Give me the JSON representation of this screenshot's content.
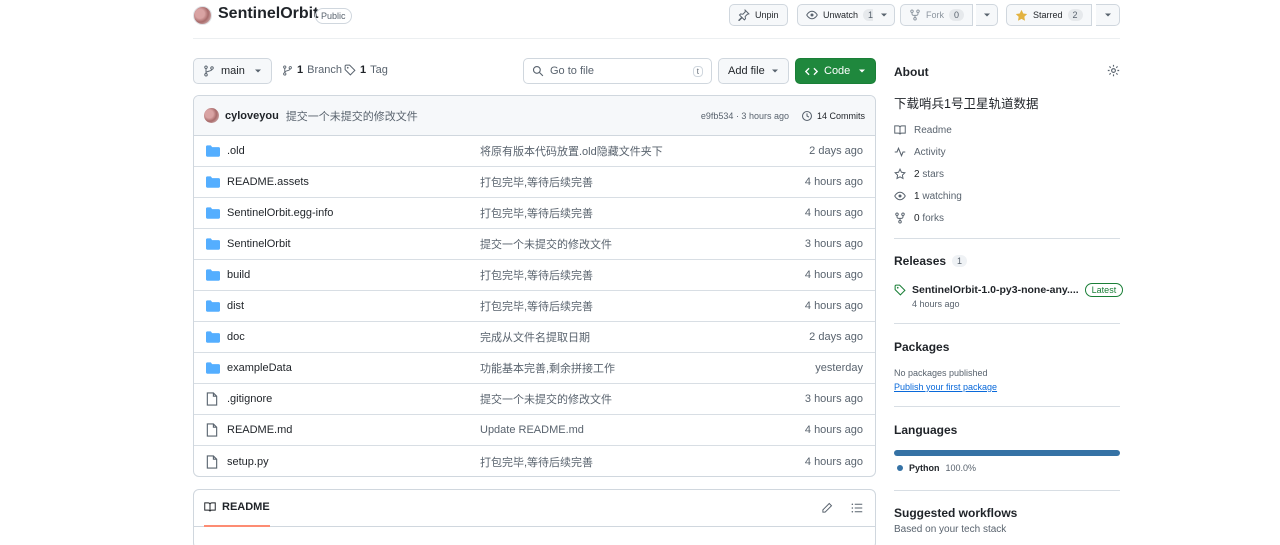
{
  "repo": {
    "name": "SentinelOrbit",
    "visibility": "Public"
  },
  "header_actions": {
    "pin_label": "Unpin",
    "watch_label": "Unwatch",
    "watch_count": "1",
    "fork_label": "Fork",
    "fork_count": "0",
    "star_label": "Starred",
    "star_count": "2"
  },
  "toolbar": {
    "branch": "main",
    "branch_count": "1",
    "branch_label": "Branch",
    "tag_count": "1",
    "tag_label": "Tag",
    "search_placeholder": "Go to file",
    "search_shortcut": "t",
    "add_file_label": "Add file",
    "code_label": "Code"
  },
  "commit": {
    "author": "cyloveyou",
    "message": "提交一个未提交的修改文件",
    "hash_time": "e9fb534 · 3 hours ago",
    "commits_label": "14 Commits"
  },
  "files": [
    {
      "type": "folder",
      "name": ".old",
      "message": "将原有版本代码放置.old隐藏文件夹下",
      "time": "2 days ago"
    },
    {
      "type": "folder",
      "name": "README.assets",
      "message": "打包完毕,等待后续完善",
      "time": "4 hours ago"
    },
    {
      "type": "folder",
      "name": "SentinelOrbit.egg-info",
      "message": "打包完毕,等待后续完善",
      "time": "4 hours ago"
    },
    {
      "type": "folder",
      "name": "SentinelOrbit",
      "message": "提交一个未提交的修改文件",
      "time": "3 hours ago"
    },
    {
      "type": "folder",
      "name": "build",
      "message": "打包完毕,等待后续完善",
      "time": "4 hours ago"
    },
    {
      "type": "folder",
      "name": "dist",
      "message": "打包完毕,等待后续完善",
      "time": "4 hours ago"
    },
    {
      "type": "folder",
      "name": "doc",
      "message": "完成从文件名提取日期",
      "time": "2 days ago"
    },
    {
      "type": "folder",
      "name": "exampleData",
      "message": "功能基本完善,剩余拼接工作",
      "time": "yesterday"
    },
    {
      "type": "file",
      "name": ".gitignore",
      "message": "提交一个未提交的修改文件",
      "time": "3 hours ago"
    },
    {
      "type": "file",
      "name": "README.md",
      "message": "Update README.md",
      "time": "4 hours ago"
    },
    {
      "type": "file",
      "name": "setup.py",
      "message": "打包完毕,等待后续完善",
      "time": "4 hours ago"
    }
  ],
  "readme": {
    "tab_label": "README"
  },
  "about": {
    "title": "About",
    "description": "下载哨兵1号卫星轨道数据",
    "links": [
      {
        "icon": "book-icon",
        "label": "Readme"
      },
      {
        "icon": "pulse-icon",
        "label": "Activity"
      },
      {
        "icon": "star-icon",
        "count": "2",
        "label": "stars"
      },
      {
        "icon": "eye-icon",
        "count": "1",
        "label": "watching"
      },
      {
        "icon": "fork-icon",
        "count": "0",
        "label": "forks"
      }
    ]
  },
  "releases": {
    "title": "Releases",
    "count": "1",
    "latest_name": "SentinelOrbit-1.0-py3-none-any....",
    "latest_badge": "Latest",
    "latest_time": "4 hours ago"
  },
  "packages": {
    "title": "Packages",
    "empty_text": "No packages published",
    "publish_link": "Publish your first package"
  },
  "languages": {
    "title": "Languages",
    "items": [
      {
        "name": "Python",
        "percent": "100.0%",
        "share": 1.0,
        "color": "#3572A5"
      }
    ]
  },
  "workflows": {
    "title": "Suggested workflows",
    "subtitle": "Based on your tech stack"
  }
}
